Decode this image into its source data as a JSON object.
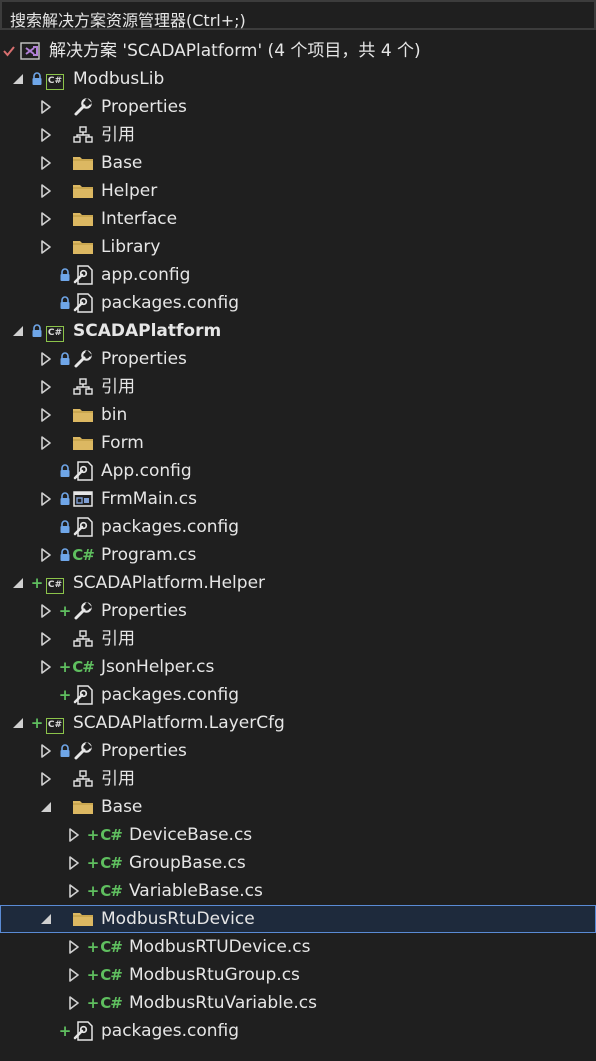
{
  "search": {
    "placeholder": "搜索解决方案资源管理器(Ctrl+;)"
  },
  "solution": {
    "label": "解决方案 'SCADAPlatform' (4 个项目，共 4 个)"
  },
  "tree": [
    {
      "label": "ModbusLib"
    },
    {
      "label": "Properties"
    },
    {
      "label": "引用"
    },
    {
      "label": "Base"
    },
    {
      "label": "Helper"
    },
    {
      "label": "Interface"
    },
    {
      "label": "Library"
    },
    {
      "label": "app.config"
    },
    {
      "label": "packages.config"
    },
    {
      "label": "SCADAPlatform"
    },
    {
      "label": "Properties"
    },
    {
      "label": "引用"
    },
    {
      "label": "bin"
    },
    {
      "label": "Form"
    },
    {
      "label": "App.config"
    },
    {
      "label": "FrmMain.cs"
    },
    {
      "label": "packages.config"
    },
    {
      "label": "Program.cs"
    },
    {
      "label": "SCADAPlatform.Helper"
    },
    {
      "label": "Properties"
    },
    {
      "label": "引用"
    },
    {
      "label": "JsonHelper.cs"
    },
    {
      "label": "packages.config"
    },
    {
      "label": "SCADAPlatform.LayerCfg"
    },
    {
      "label": "Properties"
    },
    {
      "label": "引用"
    },
    {
      "label": "Base"
    },
    {
      "label": "DeviceBase.cs"
    },
    {
      "label": "GroupBase.cs"
    },
    {
      "label": "VariableBase.cs"
    },
    {
      "label": "ModbusRtuDevice"
    },
    {
      "label": "ModbusRTUDevice.cs"
    },
    {
      "label": "ModbusRtuGroup.cs"
    },
    {
      "label": "ModbusRtuVariable.cs"
    },
    {
      "label": "packages.config"
    }
  ],
  "colors": {
    "background": "#1f1f1f",
    "accent": "#5a8bd5",
    "csharp": "#5fbf5f",
    "folder": "#dcb862"
  }
}
